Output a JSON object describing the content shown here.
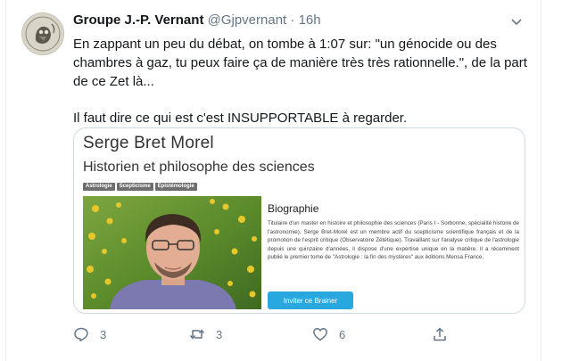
{
  "tweet": {
    "display_name": "Groupe J.-P. Vernant",
    "handle": "@Gjpvernant",
    "separator": "·",
    "time": "16h",
    "paragraphs": [
      "En zappant un peu du débat, on tombe à 1:07 sur: \"un génocide ou des chambres à gaz, tu peux faire ça de manière très très rationnelle.\", de la part de ce Zet là...",
      "Il faut dire ce qui est c'est INSUPPORTABLE à regarder."
    ]
  },
  "card": {
    "name": "Serge Bret Morel",
    "subtitle": "Historien et philosophe des sciences",
    "tags": [
      "Astrologie",
      "Scepticisme",
      "Epistémologie"
    ],
    "bio_title": "Biographie",
    "bio_text": "Titulaire d'un master en histoire et philosophie des sciences (Paris I - Sorbonne, spécialité histoire de l'astronomie), Serge Bret-Morel est un membre actif du scepticisme scientifique français et de la promotion de l'esprit critique (Observatoire Zététique). Travaillant sur l'analyse critique de l'astrologie depuis une quinzaine d'années, il dispose d'une expertise unique en la matière. Il a récemment publié le premier tome de \"Astrologie : la fin des mystères\" aux éditions Mensa France.",
    "button_label": "Inviter ce Brainer"
  },
  "actions": {
    "reply_count": "3",
    "retweet_count": "3",
    "like_count": "6"
  },
  "icons": [
    "reply-icon",
    "retweet-icon",
    "like-icon",
    "share-icon",
    "caret-down-icon"
  ],
  "colors": {
    "text": "#14171a",
    "meta": "#657786",
    "card_border": "#cfd9de",
    "button": "#29a8e0"
  }
}
